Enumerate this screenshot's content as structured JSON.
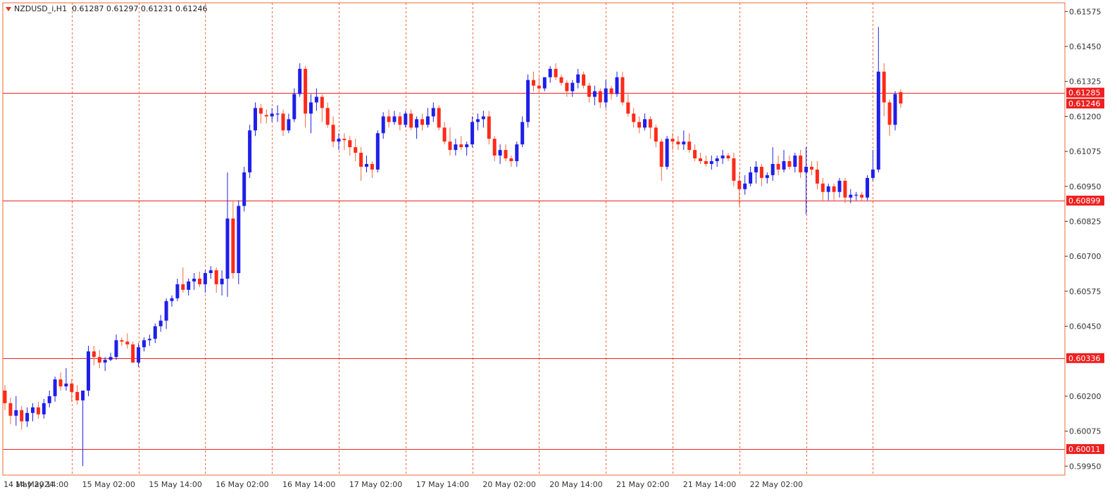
{
  "header": {
    "symbol": "NZDUSD_i,H1",
    "ohlc": "0.61287 0.61297 0.61231 0.61246"
  },
  "colors": {
    "bull": "#1f1fe8",
    "bear": "#ff2a1a",
    "wick_bull": "#1f1fe8",
    "wick_bear": "#f06a3a",
    "grid": "#f06a3a",
    "hline": "#ee2222",
    "axis_text": "#333333",
    "label_bg": "#ee2020",
    "label_text": "#ffffff"
  },
  "chart_data": {
    "type": "candlestick",
    "title": "NZDUSD_i,H1",
    "y_axis": {
      "ylim": [
        0.59918,
        0.61606
      ],
      "ticks": [
        "0.61575",
        "0.61450",
        "0.61325",
        "0.61200",
        "0.61075",
        "0.60950",
        "0.60825",
        "0.60700",
        "0.60575",
        "0.60450",
        "0.60200",
        "0.60075",
        "0.59950"
      ]
    },
    "x_axis": {
      "labels": [
        "14 May 2024",
        "14 May 14:00",
        "15 May 02:00",
        "15 May 14:00",
        "16 May 02:00",
        "16 May 14:00",
        "17 May 02:00",
        "17 May 14:00",
        "20 May 02:00",
        "20 May 14:00",
        "21 May 02:00",
        "21 May 14:00",
        "22 May 02:00"
      ],
      "label_bar_index": [
        0,
        12,
        24,
        36,
        48,
        60,
        72,
        84,
        96,
        108,
        120,
        132,
        144
      ]
    },
    "grid": true,
    "horizontal_levels": [
      "0.61285",
      "0.60899",
      "0.60336",
      "0.60011"
    ],
    "price_labels": [
      "0.61285",
      "0.61246",
      "0.60899",
      "0.60336",
      "0.60011"
    ],
    "candles": [
      [
        0.6022,
        0.6024,
        0.6015,
        0.60175
      ],
      [
        0.60175,
        0.60195,
        0.601,
        0.6013
      ],
      [
        0.6013,
        0.602,
        0.60095,
        0.6015
      ],
      [
        0.6015,
        0.60165,
        0.6008,
        0.6011
      ],
      [
        0.6011,
        0.6016,
        0.6009,
        0.6014
      ],
      [
        0.6014,
        0.60175,
        0.6011,
        0.6016
      ],
      [
        0.6016,
        0.6018,
        0.6012,
        0.60135
      ],
      [
        0.60135,
        0.6019,
        0.6012,
        0.60175
      ],
      [
        0.60175,
        0.6022,
        0.6016,
        0.602
      ],
      [
        0.602,
        0.6027,
        0.6018,
        0.6026
      ],
      [
        0.6026,
        0.60285,
        0.6022,
        0.60235
      ],
      [
        0.60235,
        0.603,
        0.6022,
        0.60245
      ],
      [
        0.60245,
        0.6026,
        0.6018,
        0.60215
      ],
      [
        0.60215,
        0.6024,
        0.6017,
        0.60185
      ],
      [
        0.60185,
        0.6022,
        0.5995,
        0.6022
      ],
      [
        0.6022,
        0.6038,
        0.602,
        0.6036
      ],
      [
        0.6036,
        0.6038,
        0.6031,
        0.6034
      ],
      [
        0.6034,
        0.60365,
        0.603,
        0.6032
      ],
      [
        0.6032,
        0.6034,
        0.6029,
        0.6033
      ],
      [
        0.6033,
        0.60355,
        0.60325,
        0.6034
      ],
      [
        0.6034,
        0.6042,
        0.6033,
        0.604
      ],
      [
        0.604,
        0.6041,
        0.6038,
        0.60395
      ],
      [
        0.60395,
        0.60425,
        0.6037,
        0.60385
      ],
      [
        0.60385,
        0.60395,
        0.6032,
        0.6032
      ],
      [
        0.6032,
        0.6039,
        0.60305,
        0.60375
      ],
      [
        0.60375,
        0.6041,
        0.6036,
        0.604
      ],
      [
        0.604,
        0.6042,
        0.6038,
        0.60405
      ],
      [
        0.60405,
        0.6046,
        0.6039,
        0.6045
      ],
      [
        0.6045,
        0.6049,
        0.6043,
        0.6047
      ],
      [
        0.6047,
        0.6055,
        0.6044,
        0.6054
      ],
      [
        0.6054,
        0.6056,
        0.6052,
        0.6055
      ],
      [
        0.6055,
        0.6062,
        0.6054,
        0.606
      ],
      [
        0.606,
        0.6066,
        0.6057,
        0.6058
      ],
      [
        0.6058,
        0.6062,
        0.6056,
        0.6061
      ],
      [
        0.6061,
        0.6064,
        0.6058,
        0.6062
      ],
      [
        0.6062,
        0.60645,
        0.6059,
        0.606
      ],
      [
        0.606,
        0.6065,
        0.6057,
        0.6064
      ],
      [
        0.6064,
        0.60665,
        0.6062,
        0.6065
      ],
      [
        0.6065,
        0.6066,
        0.6057,
        0.606
      ],
      [
        0.606,
        0.6065,
        0.6056,
        0.6062
      ],
      [
        0.6062,
        0.61,
        0.60555,
        0.60835
      ],
      [
        0.60835,
        0.609,
        0.6062,
        0.6064
      ],
      [
        0.6064,
        0.609,
        0.606,
        0.6088
      ],
      [
        0.6088,
        0.6102,
        0.6086,
        0.61
      ],
      [
        0.61,
        0.6117,
        0.6098,
        0.6115
      ],
      [
        0.6115,
        0.6125,
        0.6113,
        0.6123
      ],
      [
        0.6123,
        0.61245,
        0.61175,
        0.6121
      ],
      [
        0.61205,
        0.61225,
        0.61175,
        0.612
      ],
      [
        0.612,
        0.6123,
        0.6118,
        0.6121
      ],
      [
        0.6121,
        0.6124,
        0.6118,
        0.6121
      ],
      [
        0.6121,
        0.61225,
        0.6113,
        0.6115
      ],
      [
        0.6115,
        0.6121,
        0.6114,
        0.6119
      ],
      [
        0.6119,
        0.613,
        0.6118,
        0.6128
      ],
      [
        0.6128,
        0.6139,
        0.6127,
        0.6137
      ],
      [
        0.6137,
        0.6138,
        0.6116,
        0.6121
      ],
      [
        0.6121,
        0.6128,
        0.6114,
        0.6125
      ],
      [
        0.6125,
        0.613,
        0.6122,
        0.6127
      ],
      [
        0.6127,
        0.6128,
        0.6118,
        0.6123
      ],
      [
        0.6123,
        0.6125,
        0.6116,
        0.6117
      ],
      [
        0.6117,
        0.612,
        0.6109,
        0.6111
      ],
      [
        0.6111,
        0.6114,
        0.6108,
        0.6112
      ],
      [
        0.6112,
        0.6114,
        0.6108,
        0.61115
      ],
      [
        0.61115,
        0.6113,
        0.6106,
        0.6109
      ],
      [
        0.6109,
        0.6112,
        0.6104,
        0.6107
      ],
      [
        0.6107,
        0.6109,
        0.6097,
        0.6102
      ],
      [
        0.6102,
        0.6106,
        0.61,
        0.6103
      ],
      [
        0.6103,
        0.6104,
        0.6098,
        0.6101
      ],
      [
        0.6101,
        0.6115,
        0.61,
        0.6114
      ],
      [
        0.6114,
        0.61215,
        0.6112,
        0.612
      ],
      [
        0.612,
        0.61225,
        0.6116,
        0.6118
      ],
      [
        0.6118,
        0.6122,
        0.6117,
        0.612
      ],
      [
        0.612,
        0.61215,
        0.6115,
        0.6117
      ],
      [
        0.6117,
        0.6122,
        0.6116,
        0.6121
      ],
      [
        0.6121,
        0.61225,
        0.6115,
        0.6116
      ],
      [
        0.6116,
        0.612,
        0.6112,
        0.6119
      ],
      [
        0.6119,
        0.6121,
        0.6115,
        0.6117
      ],
      [
        0.6117,
        0.6123,
        0.6116,
        0.612
      ],
      [
        0.612,
        0.6125,
        0.6118,
        0.6123
      ],
      [
        0.6123,
        0.6124,
        0.6115,
        0.6116
      ],
      [
        0.6116,
        0.6118,
        0.611,
        0.6111
      ],
      [
        0.6111,
        0.6116,
        0.6106,
        0.6108
      ],
      [
        0.6108,
        0.6112,
        0.6106,
        0.611
      ],
      [
        0.611,
        0.6113,
        0.6108,
        0.6109
      ],
      [
        0.6109,
        0.6111,
        0.6106,
        0.611
      ],
      [
        0.611,
        0.612,
        0.6109,
        0.6118
      ],
      [
        0.6118,
        0.6121,
        0.6115,
        0.6119
      ],
      [
        0.6119,
        0.6122,
        0.6116,
        0.612
      ],
      [
        0.612,
        0.6122,
        0.611,
        0.6112
      ],
      [
        0.6112,
        0.6113,
        0.6104,
        0.6106
      ],
      [
        0.6106,
        0.611,
        0.6103,
        0.6108
      ],
      [
        0.6108,
        0.611,
        0.6104,
        0.6105
      ],
      [
        0.6105,
        0.6106,
        0.6102,
        0.6104
      ],
      [
        0.6104,
        0.6111,
        0.6102,
        0.611
      ],
      [
        0.611,
        0.612,
        0.6109,
        0.6118
      ],
      [
        0.6118,
        0.6135,
        0.6116,
        0.6133
      ],
      [
        0.6133,
        0.6136,
        0.6129,
        0.6131
      ],
      [
        0.6131,
        0.6134,
        0.6128,
        0.613
      ],
      [
        0.613,
        0.6134,
        0.6129,
        0.6134
      ],
      [
        0.6134,
        0.6138,
        0.6132,
        0.6137
      ],
      [
        0.6137,
        0.6139,
        0.6133,
        0.6134
      ],
      [
        0.6134,
        0.6135,
        0.6131,
        0.6132
      ],
      [
        0.6132,
        0.6133,
        0.6127,
        0.6129
      ],
      [
        0.6129,
        0.6133,
        0.6127,
        0.6132
      ],
      [
        0.6132,
        0.6137,
        0.613,
        0.6135
      ],
      [
        0.6135,
        0.6136,
        0.613,
        0.6131
      ],
      [
        0.6131,
        0.6132,
        0.6125,
        0.6127
      ],
      [
        0.6127,
        0.6131,
        0.6124,
        0.6129
      ],
      [
        0.6129,
        0.613,
        0.6123,
        0.6125
      ],
      [
        0.6125,
        0.6133,
        0.6123,
        0.613
      ],
      [
        0.613,
        0.6131,
        0.6126,
        0.6128
      ],
      [
        0.6128,
        0.6136,
        0.6127,
        0.6134
      ],
      [
        0.6134,
        0.6136,
        0.6124,
        0.6125
      ],
      [
        0.6125,
        0.6128,
        0.612,
        0.6121
      ],
      [
        0.6121,
        0.6123,
        0.6116,
        0.6118
      ],
      [
        0.6118,
        0.612,
        0.6114,
        0.6116
      ],
      [
        0.6116,
        0.6121,
        0.6115,
        0.6119
      ],
      [
        0.6119,
        0.612,
        0.6112,
        0.6116
      ],
      [
        0.6116,
        0.6117,
        0.6109,
        0.6111
      ],
      [
        0.6111,
        0.6112,
        0.6097,
        0.6102
      ],
      [
        0.6102,
        0.6113,
        0.6101,
        0.6112
      ],
      [
        0.6112,
        0.6114,
        0.6108,
        0.6111
      ],
      [
        0.6111,
        0.6113,
        0.6108,
        0.611
      ],
      [
        0.611,
        0.6115,
        0.6108,
        0.6111
      ],
      [
        0.6111,
        0.6114,
        0.6107,
        0.6108
      ],
      [
        0.6108,
        0.611,
        0.6104,
        0.6105
      ],
      [
        0.6105,
        0.6107,
        0.6103,
        0.6104
      ],
      [
        0.6104,
        0.6106,
        0.6102,
        0.6103
      ],
      [
        0.6103,
        0.6106,
        0.6101,
        0.6104
      ],
      [
        0.6104,
        0.6106,
        0.6102,
        0.6105
      ],
      [
        0.6105,
        0.6108,
        0.6103,
        0.6106
      ],
      [
        0.6106,
        0.6107,
        0.6104,
        0.6105
      ],
      [
        0.6105,
        0.6107,
        0.6095,
        0.6097
      ],
      [
        0.6097,
        0.61,
        0.6088,
        0.6094
      ],
      [
        0.6094,
        0.6099,
        0.6092,
        0.6096
      ],
      [
        0.6096,
        0.6102,
        0.6095,
        0.61
      ],
      [
        0.61,
        0.6104,
        0.6096,
        0.6102
      ],
      [
        0.6102,
        0.6103,
        0.6095,
        0.6098
      ],
      [
        0.6098,
        0.61,
        0.6096,
        0.6099
      ],
      [
        0.6099,
        0.6109,
        0.6097,
        0.6103
      ],
      [
        0.6103,
        0.6106,
        0.6099,
        0.6101
      ],
      [
        0.6101,
        0.6108,
        0.61,
        0.6104
      ],
      [
        0.6104,
        0.6106,
        0.6101,
        0.6102
      ],
      [
        0.6102,
        0.6107,
        0.61,
        0.6106
      ],
      [
        0.6106,
        0.6108,
        0.6098,
        0.61
      ],
      [
        0.61,
        0.6109,
        0.6085,
        0.6102
      ],
      [
        0.6102,
        0.6104,
        0.6099,
        0.6101
      ],
      [
        0.6101,
        0.6104,
        0.6094,
        0.6096
      ],
      [
        0.6096,
        0.6098,
        0.609,
        0.6093
      ],
      [
        0.6093,
        0.6096,
        0.609,
        0.6095
      ],
      [
        0.6095,
        0.6096,
        0.609,
        0.6093
      ],
      [
        0.6093,
        0.6098,
        0.6091,
        0.6097
      ],
      [
        0.6097,
        0.6098,
        0.6089,
        0.6091
      ],
      [
        0.6091,
        0.6094,
        0.6089,
        0.6092
      ],
      [
        0.6092,
        0.6093,
        0.609,
        0.6092
      ],
      [
        0.6092,
        0.6093,
        0.609,
        0.6091
      ],
      [
        0.6091,
        0.6099,
        0.609,
        0.6098
      ],
      [
        0.6098,
        0.6108,
        0.6097,
        0.6101
      ],
      [
        0.6101,
        0.6152,
        0.61,
        0.6136
      ],
      [
        0.6136,
        0.6139,
        0.612,
        0.6125
      ],
      [
        0.6125,
        0.6126,
        0.6113,
        0.6117
      ],
      [
        0.6117,
        0.6129,
        0.6115,
        0.6128
      ],
      [
        0.61287,
        0.61297,
        0.61231,
        0.61246
      ]
    ]
  }
}
